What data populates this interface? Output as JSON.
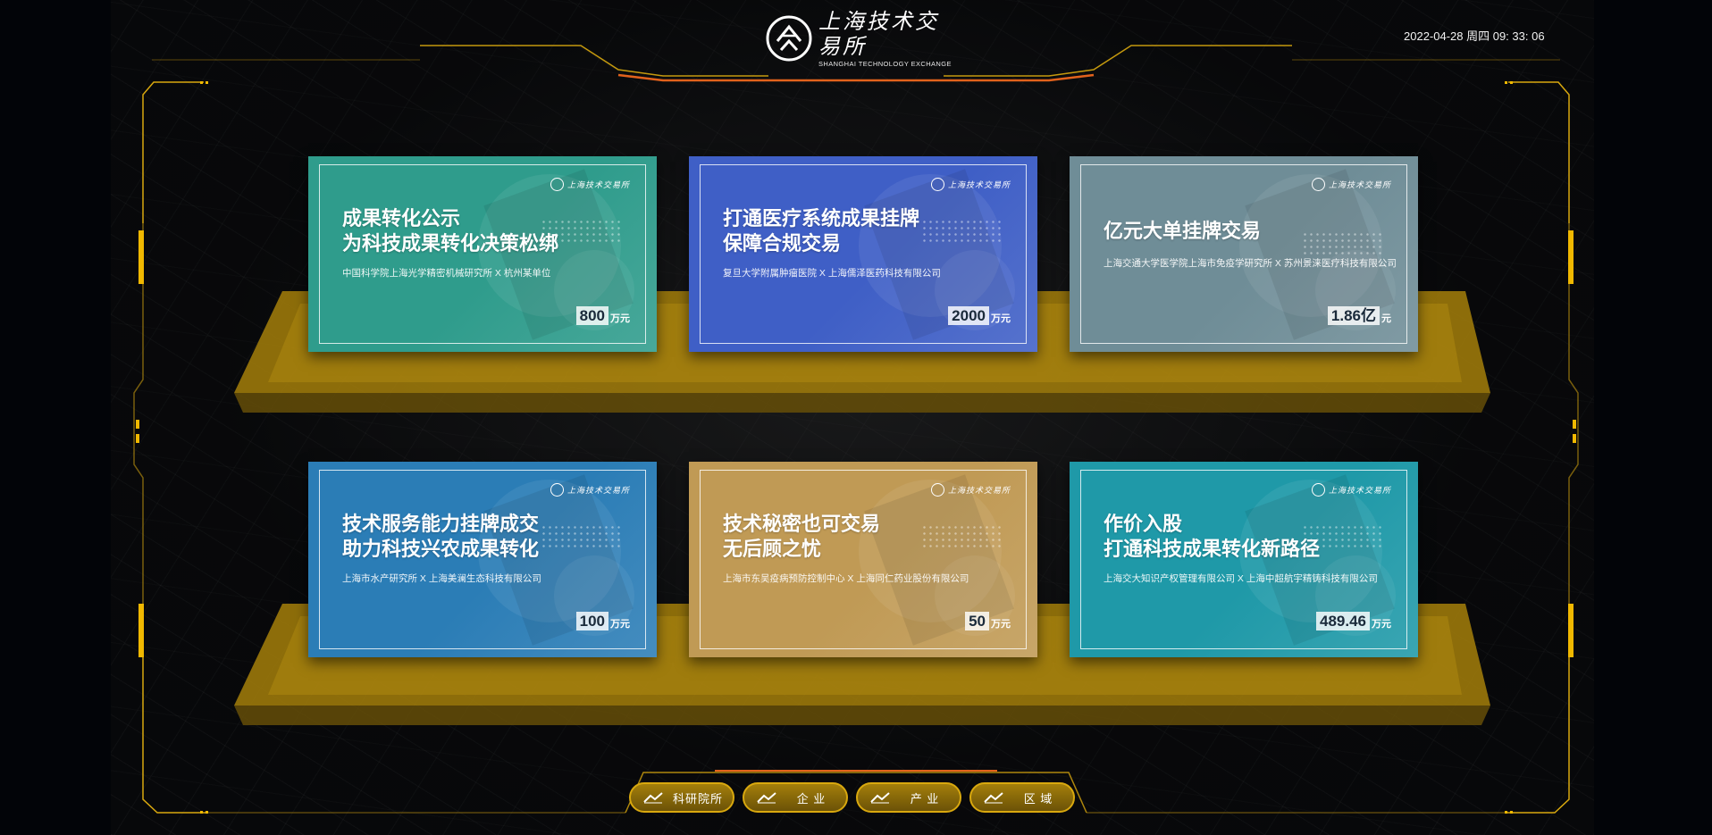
{
  "header": {
    "logo_cn": "上海技术交易所",
    "logo_en": "SHANGHAI TECHNOLOGY EXCHANGE",
    "datetime": "2022-04-28 周四 09: 33: 06"
  },
  "colors": {
    "frame_gold": "#d9a80e",
    "frame_orange": "#e2621c",
    "shelf": "#a47f0b",
    "background": "#020408"
  },
  "cards": [
    {
      "title": "成果转化公示\n为科技成果转化决策松绑",
      "parties": "中国科学院上海光学精密机械研究所 X 杭州某单位",
      "amount": "800",
      "unit": "万元",
      "color": "#2f9c8c"
    },
    {
      "title": "打通医疗系统成果挂牌\n保障合规交易",
      "parties": "复旦大学附属肿瘤医院 X 上海儒泽医药科技有限公司",
      "amount": "2000",
      "unit": "万元",
      "color": "#3f5fc6"
    },
    {
      "title": "亿元大单挂牌交易",
      "parties": "上海交通大学医学院上海市免疫学研究所 X 苏州景涞医疗科技有限公司",
      "amount": "1.86亿",
      "unit": "元",
      "color": "#6f8d97"
    },
    {
      "title": "技术服务能力挂牌成交\n助力科技兴农成果转化",
      "parties": "上海市水产研究所 X 上海美澜生态科技有限公司",
      "amount": "100",
      "unit": "万元",
      "color": "#2b7db6"
    },
    {
      "title": "技术秘密也可交易\n无后顾之忧",
      "parties": "上海市东吴疫病预防控制中心 X 上海同仁药业股份有限公司",
      "amount": "50",
      "unit": "万元",
      "color": "#c09a55"
    },
    {
      "title": "作价入股\n打通科技成果转化新路径",
      "parties": "上海交大知识产权管理有限公司 X 上海中超航宇精铸科技有限公司",
      "amount": "489.46",
      "unit": "万元",
      "color": "#1f99a8"
    }
  ],
  "tabs": [
    {
      "label": "科研院所",
      "icon": "trend-line-icon"
    },
    {
      "label": "企 业",
      "icon": "trend-line-icon"
    },
    {
      "label": "产 业",
      "icon": "trend-line-icon"
    },
    {
      "label": "区 域",
      "icon": "trend-line-icon"
    }
  ]
}
